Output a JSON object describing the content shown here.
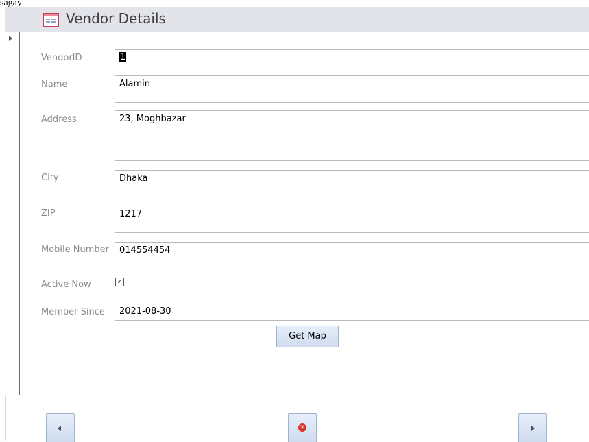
{
  "top_strip_text": "sagay",
  "form": {
    "title": "Vendor Details",
    "icon": "form-icon"
  },
  "fields": {
    "vendor_id": {
      "label": "VendorID",
      "value": "1"
    },
    "name": {
      "label": "Name",
      "value": "Alamin"
    },
    "address": {
      "label": "Address",
      "value": "23, Moghbazar"
    },
    "city": {
      "label": "City",
      "value": "Dhaka"
    },
    "zip": {
      "label": "ZIP",
      "value": "1217"
    },
    "mobile": {
      "label": "Mobile Number",
      "value": "014554454"
    },
    "active": {
      "label": "Active Now",
      "checked": true,
      "glyph": "✓"
    },
    "member_since": {
      "label": "Member Since",
      "value": "2021-08-30"
    }
  },
  "buttons": {
    "get_map": "Get Map",
    "close_glyph": "✕"
  },
  "colors": {
    "header_bg": "#e2e4ea",
    "button_bg": "#d8e4f4",
    "close_red": "#d9322b"
  }
}
